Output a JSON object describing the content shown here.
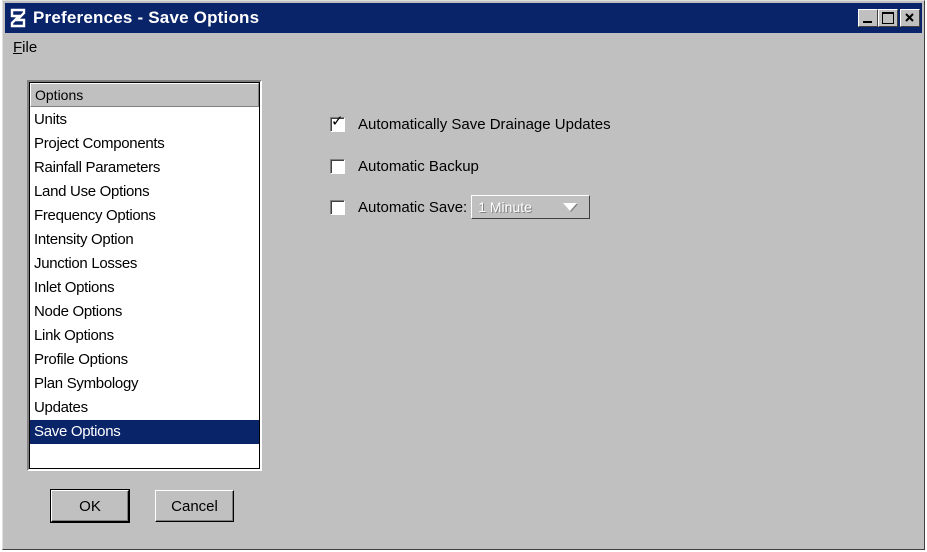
{
  "window": {
    "title": "Preferences - Save Options",
    "brand_color": "#0a246a",
    "face_color": "#c0c0c0"
  },
  "menu": {
    "file_label": "File",
    "file_mnemonic": "F",
    "file_rest": "ile"
  },
  "options": {
    "header": "Options",
    "items": [
      {
        "label": "Units"
      },
      {
        "label": "Project Components"
      },
      {
        "label": "Rainfall Parameters"
      },
      {
        "label": "Land Use Options"
      },
      {
        "label": "Frequency Options"
      },
      {
        "label": "Intensity Option"
      },
      {
        "label": "Junction Losses"
      },
      {
        "label": "Inlet Options"
      },
      {
        "label": "Node Options"
      },
      {
        "label": "Link Options"
      },
      {
        "label": "Profile Options"
      },
      {
        "label": "Plan Symbology"
      },
      {
        "label": "Updates"
      },
      {
        "label": "Save Options"
      }
    ],
    "selected": "Save Options"
  },
  "buttons": {
    "ok": "OK",
    "cancel": "Cancel"
  },
  "settings": {
    "auto_save_drainage": {
      "label": "Automatically Save Drainage Updates",
      "checked": true
    },
    "auto_backup": {
      "label": "Automatic Backup",
      "checked": false
    },
    "auto_save": {
      "label": "Automatic Save:",
      "checked": false,
      "interval_value": "1 Minute",
      "enabled": false
    }
  },
  "icons": {
    "app": "app-logo-icon",
    "minimize": "minimize-icon",
    "maximize": "maximize-icon",
    "close": "close-icon",
    "check": "checkmark-icon",
    "dropdown": "chevron-down-icon"
  }
}
